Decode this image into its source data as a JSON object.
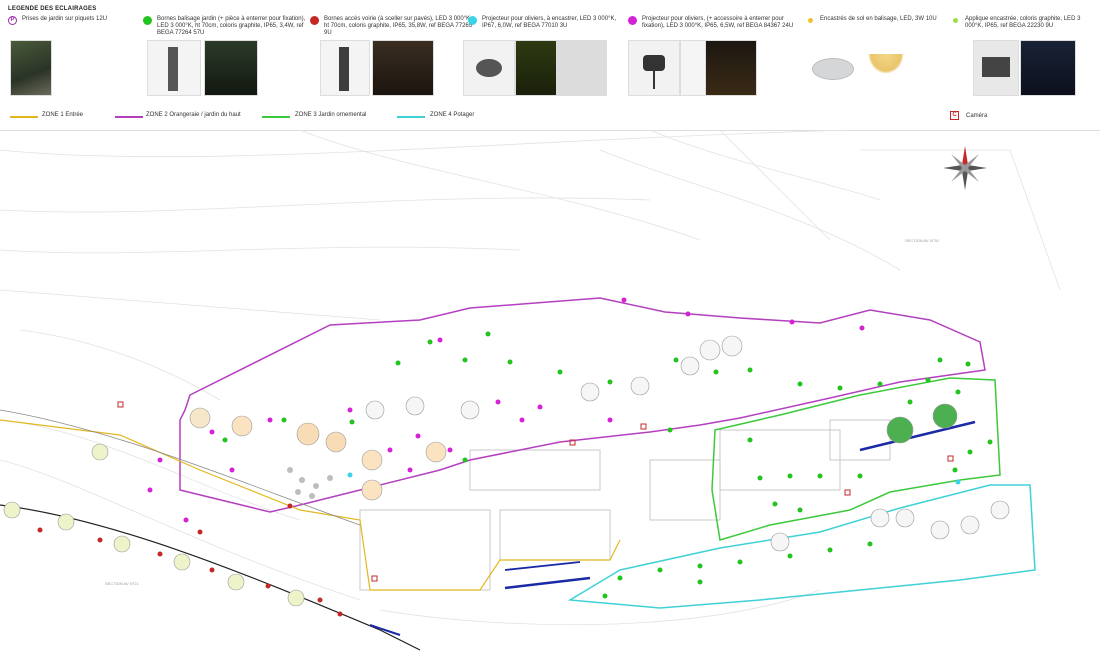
{
  "legend": {
    "title": "LEGENDE DES ECLAIRAGES",
    "items": [
      {
        "id": "pique",
        "label": "Prises de jardin sur piquets  12U",
        "color": "#9c27b0",
        "glyph": "P"
      },
      {
        "id": "borne-jardin",
        "label": "Bornes balisage jardin (+ pièce à enterrer pour fixation), LED 3 000°K, ht 70cm, coloris graphite, IP65, 3,4W, ref BEGA 77264  57U",
        "color": "#22c41d"
      },
      {
        "id": "borne-voirie",
        "label": "Bornes accès voirie (à sceller sur pavés), LED 3 000°K, ht 70cm, coloris graphite, IP65, 35,8W, ref BEGA 77265  9U",
        "color": "#c62828"
      },
      {
        "id": "projecteur-encastrer",
        "label": "Projecteur pour oliviers, à encastrer, LED 3 000°K, IP67, 6,0W, ref BEGA 77010  3U",
        "color": "#3ad3e8"
      },
      {
        "id": "projecteur-enterrer",
        "label": "Projecteur pour oliviers, (+ accessoire à enterrer pour fixation), LED 3 000°K, IP65, 6,5W, ref BEGA 84367  24U",
        "color": "#d622d6"
      },
      {
        "id": "encastre-sol",
        "label": "Encastrés de sol en balisage, LED, 3W  10U",
        "color": "#f2c12e"
      },
      {
        "id": "applique",
        "label": "Applique encastrée, coloris graphite, LED  3 000°K, IP65, ref BEGA 22230    9U",
        "color": "#9be04a"
      }
    ]
  },
  "zones": [
    {
      "id": "zone1",
      "label": "ZONE 1 Entrée",
      "color": "#e3b81f"
    },
    {
      "id": "zone2",
      "label": "ZONE 2 Orangeraie / jardin du haut",
      "color": "#b43fbf"
    },
    {
      "id": "zone3",
      "label": "ZONE 3 Jardin ornemental",
      "color": "#3cc93c"
    },
    {
      "id": "zone4",
      "label": "ZONE 4 Potager",
      "color": "#3fd1d6"
    }
  ],
  "camera": {
    "label": "Caméra",
    "glyph": "C",
    "color": "#c62828"
  },
  "map": {
    "section_labels": [
      "SECTION AV N°30",
      "SECTION AV N°21"
    ],
    "accent_blue": "#1a2aa6"
  }
}
